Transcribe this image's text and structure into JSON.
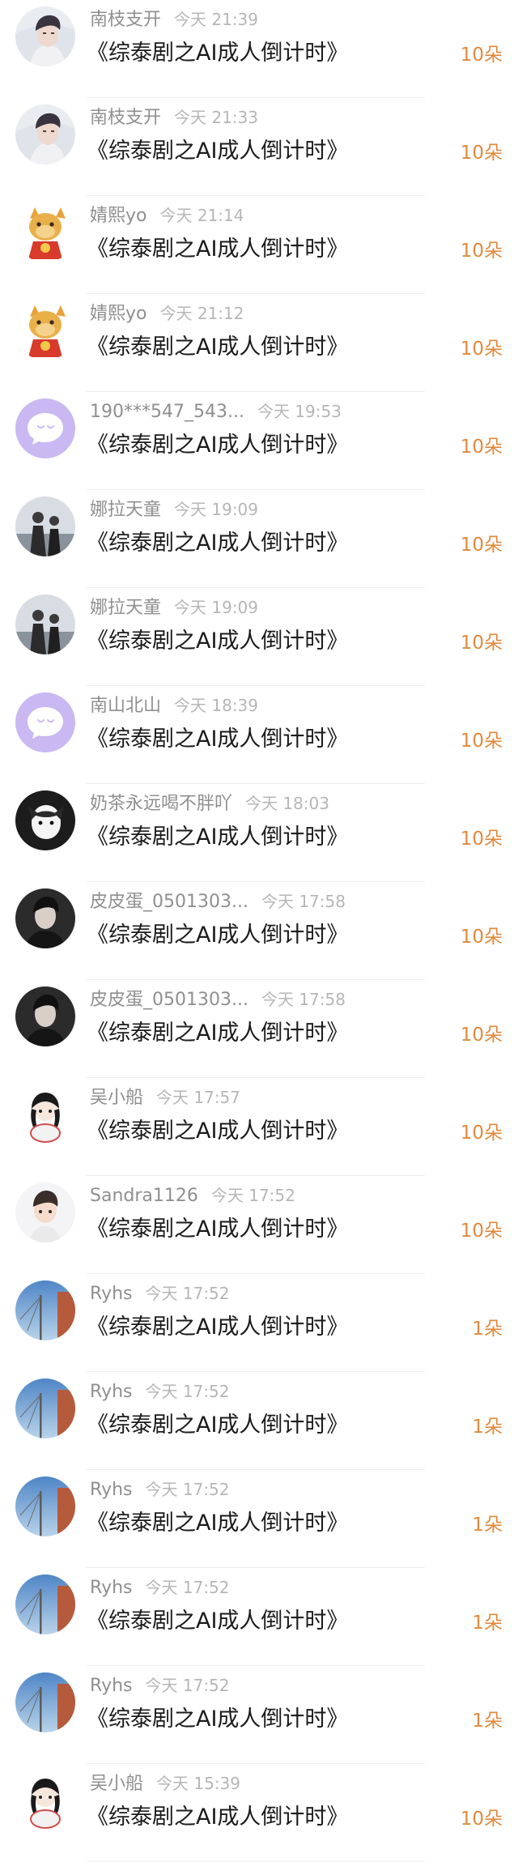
{
  "avatars": {
    "nanzhi": "portrait-avatar",
    "jingxi": "dragon-avatar",
    "default": "default-chat-avatar",
    "nala": "couple-photo-avatar",
    "naicha": "cat-avatar",
    "pipidan": "portrait-avatar-dark",
    "wuxiaochuan": "cartoon-girl-avatar",
    "sandra": "cartoon-boy-avatar",
    "ryhs": "sky-pole-avatar"
  },
  "colors": {
    "username": "#8f8f8f",
    "time": "#b6b6b6",
    "title": "#1b1b1b",
    "amount": "#e08a3e",
    "divider": "#ededed"
  },
  "rows": [
    {
      "avatar": "nanzhi",
      "user": "南枝支开",
      "time": "今天 21:39",
      "title": "《综泰剧之AI成人倒计时》",
      "amount": "10朵"
    },
    {
      "avatar": "nanzhi",
      "user": "南枝支开",
      "time": "今天 21:33",
      "title": "《综泰剧之AI成人倒计时》",
      "amount": "10朵"
    },
    {
      "avatar": "jingxi",
      "user": "婧熙yo",
      "time": "今天 21:14",
      "title": "《综泰剧之AI成人倒计时》",
      "amount": "10朵"
    },
    {
      "avatar": "jingxi",
      "user": "婧熙yo",
      "time": "今天 21:12",
      "title": "《综泰剧之AI成人倒计时》",
      "amount": "10朵"
    },
    {
      "avatar": "default",
      "user": "190***547_543...",
      "time": "今天 19:53",
      "title": "《综泰剧之AI成人倒计时》",
      "amount": "10朵"
    },
    {
      "avatar": "nala",
      "user": "娜拉天童",
      "time": "今天 19:09",
      "title": "《综泰剧之AI成人倒计时》",
      "amount": "10朵"
    },
    {
      "avatar": "nala",
      "user": "娜拉天童",
      "time": "今天 19:09",
      "title": "《综泰剧之AI成人倒计时》",
      "amount": "10朵"
    },
    {
      "avatar": "default",
      "user": "南山北山",
      "time": "今天 18:39",
      "title": "《综泰剧之AI成人倒计时》",
      "amount": "10朵"
    },
    {
      "avatar": "naicha",
      "user": "奶茶永远喝不胖吖",
      "time": "今天 18:03",
      "title": "《综泰剧之AI成人倒计时》",
      "amount": "10朵"
    },
    {
      "avatar": "pipidan",
      "user": "皮皮蛋_0501303...",
      "time": "今天 17:58",
      "title": "《综泰剧之AI成人倒计时》",
      "amount": "10朵"
    },
    {
      "avatar": "pipidan",
      "user": "皮皮蛋_0501303...",
      "time": "今天 17:58",
      "title": "《综泰剧之AI成人倒计时》",
      "amount": "10朵"
    },
    {
      "avatar": "wuxiaochuan",
      "user": "吴小船",
      "time": "今天 17:57",
      "title": "《综泰剧之AI成人倒计时》",
      "amount": "10朵"
    },
    {
      "avatar": "sandra",
      "user": "Sandra1126",
      "time": "今天 17:52",
      "title": "《综泰剧之AI成人倒计时》",
      "amount": "10朵"
    },
    {
      "avatar": "ryhs",
      "user": "Ryhs",
      "time": "今天 17:52",
      "title": "《综泰剧之AI成人倒计时》",
      "amount": "1朵"
    },
    {
      "avatar": "ryhs",
      "user": "Ryhs",
      "time": "今天 17:52",
      "title": "《综泰剧之AI成人倒计时》",
      "amount": "1朵"
    },
    {
      "avatar": "ryhs",
      "user": "Ryhs",
      "time": "今天 17:52",
      "title": "《综泰剧之AI成人倒计时》",
      "amount": "1朵"
    },
    {
      "avatar": "ryhs",
      "user": "Ryhs",
      "time": "今天 17:52",
      "title": "《综泰剧之AI成人倒计时》",
      "amount": "1朵"
    },
    {
      "avatar": "ryhs",
      "user": "Ryhs",
      "time": "今天 17:52",
      "title": "《综泰剧之AI成人倒计时》",
      "amount": "1朵"
    },
    {
      "avatar": "wuxiaochuan",
      "user": "吴小船",
      "time": "今天 15:39",
      "title": "《综泰剧之AI成人倒计时》",
      "amount": "10朵"
    }
  ]
}
